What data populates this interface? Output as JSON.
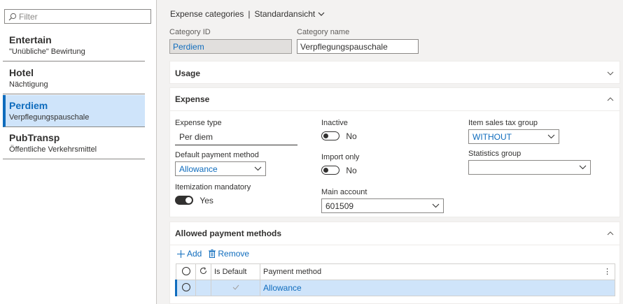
{
  "filter": {
    "placeholder": "Filter"
  },
  "list": [
    {
      "title": "Entertain",
      "subtitle": "\"Unübliche\" Bewirtung"
    },
    {
      "title": "Hotel",
      "subtitle": "Nächtigung"
    },
    {
      "title": "Perdiem",
      "subtitle": "Verpflegungspauschale"
    },
    {
      "title": "PubTransp",
      "subtitle": "Öffentliche Verkehrsmittel"
    }
  ],
  "header": {
    "page": "Expense categories",
    "separator": "|",
    "view": "Standardansicht"
  },
  "fields": {
    "category_id_label": "Category ID",
    "category_id": "Perdiem",
    "category_name_label": "Category name",
    "category_name": "Verpflegungspauschale"
  },
  "sections": {
    "usage": "Usage",
    "expense": "Expense",
    "allowed": "Allowed payment methods"
  },
  "expense": {
    "expense_type_label": "Expense type",
    "expense_type": "Per diem",
    "default_payment_label": "Default payment method",
    "default_payment": "Allowance",
    "itemization_label": "Itemization mandatory",
    "itemization_value": "Yes",
    "inactive_label": "Inactive",
    "inactive_value": "No",
    "import_only_label": "Import only",
    "import_only_value": "No",
    "main_account_label": "Main account",
    "main_account": "601509",
    "item_tax_label": "Item sales tax group",
    "item_tax": "WITHOUT",
    "stat_group_label": "Statistics group",
    "stat_group": ""
  },
  "toolbar": {
    "add": "Add",
    "remove": "Remove"
  },
  "grid": {
    "col_default": "Is Default",
    "col_method": "Payment method",
    "rows": [
      {
        "method": "Allowance"
      }
    ]
  },
  "colors": {
    "accent": "#0f6cbd",
    "selected": "#cfe4fa",
    "pane": "#f3f2f1"
  }
}
